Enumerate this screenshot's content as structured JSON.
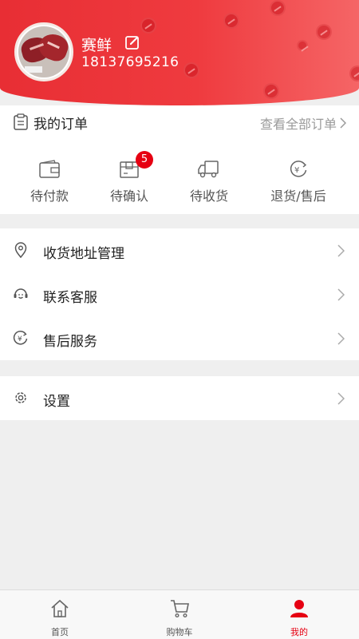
{
  "profile": {
    "name": "赛鲜",
    "phone": "18137695216"
  },
  "orders": {
    "title": "我的订单",
    "view_all": "查看全部订单",
    "items": [
      {
        "label": "待付款",
        "icon": "wallet-icon"
      },
      {
        "label": "待确认",
        "icon": "box-icon",
        "badge": "5"
      },
      {
        "label": "待收货",
        "icon": "truck-icon"
      },
      {
        "label": "退货/售后",
        "icon": "refund-icon"
      }
    ]
  },
  "menu": {
    "address": "收货地址管理",
    "service": "联系客服",
    "aftersale": "售后服务",
    "settings": "设置"
  },
  "tabbar": {
    "home": "首页",
    "cart": "购物车",
    "mine": "我的"
  },
  "colors": {
    "accent": "#e60012",
    "header_start": "#e82e34",
    "header_end": "#f56566"
  }
}
